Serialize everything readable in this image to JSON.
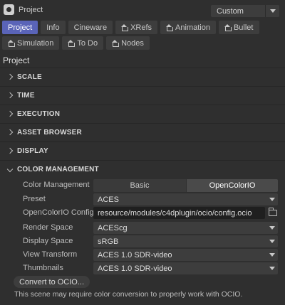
{
  "header": {
    "title": "Project",
    "mode": "Custom",
    "icon": "cinema4d-gear-icon"
  },
  "tabs": [
    {
      "label": "Project",
      "active": true,
      "home": false
    },
    {
      "label": "Info",
      "active": false,
      "home": false
    },
    {
      "label": "Cineware",
      "active": false,
      "home": false
    },
    {
      "label": "XRefs",
      "active": false,
      "home": true
    },
    {
      "label": "Animation",
      "active": false,
      "home": true
    },
    {
      "label": "Bullet",
      "active": false,
      "home": true
    },
    {
      "label": "Simulation",
      "active": false,
      "home": true
    },
    {
      "label": "To Do",
      "active": false,
      "home": true
    },
    {
      "label": "Nodes",
      "active": false,
      "home": true
    }
  ],
  "section_title": "Project",
  "groups": {
    "scale": "SCALE",
    "time": "TIME",
    "execution": "EXECUTION",
    "asset_browser": "ASSET BROWSER",
    "display": "DISPLAY",
    "color_management": "COLOR MANAGEMENT"
  },
  "color_management": {
    "mode_label": "Color Management",
    "mode_basic": "Basic",
    "mode_ocio": "OpenColorIO",
    "mode_selected": "OpenColorIO",
    "preset_label": "Preset",
    "preset_value": "ACES",
    "config_label": "OpenColorIO Config",
    "config_value": "resource/modules/c4dplugin/ocio/config.ocio",
    "render_space_label": "Render Space",
    "render_space_value": "ACEScg",
    "display_space_label": "Display Space",
    "display_space_value": "sRGB",
    "view_transform_label": "View Transform",
    "view_transform_value": "ACES 1.0 SDR-video",
    "thumbnails_label": "Thumbnails",
    "thumbnails_value": "ACES 1.0 SDR-video",
    "convert_button": "Convert to OCIO...",
    "note": "This scene may require color conversion to properly work with OCIO."
  },
  "colors": {
    "background": "#2f2f2f",
    "active_tab": "#5a64b8",
    "field": "#3d3d3d",
    "path_field": "#1f1f1f"
  }
}
